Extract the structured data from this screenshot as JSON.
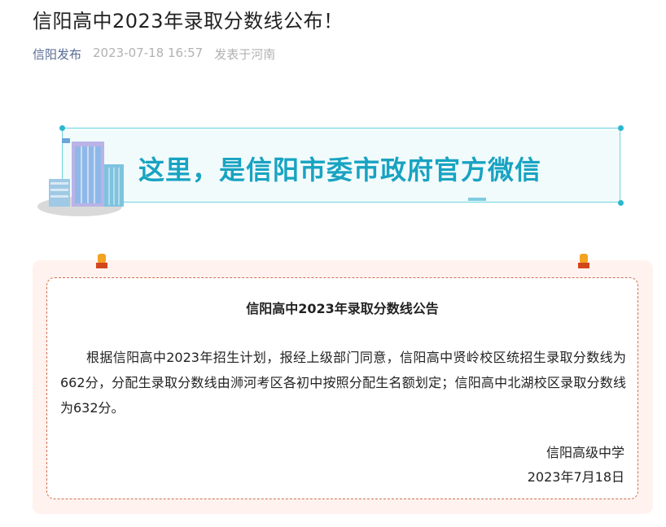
{
  "article": {
    "title": "信阳高中2023年录取分数线公布！",
    "author": "信阳发布",
    "datetime": "2023-07-18 16:57",
    "location": "发表于河南"
  },
  "banner": {
    "text": "这里，是信阳市委市政府官方微信",
    "accent_color": "#18a3c2",
    "icon": "city-buildings-illustration"
  },
  "notice": {
    "title": "信阳高中2023年录取分数线公告",
    "body": "根据信阳高中2023年招生计划，报经上级部门同意，信阳高中贤岭校区统招生录取分数线为662分，分配生录取分数线由浉河考区各初中按照分配生名额划定；信阳高中北湖校区录取分数线为632分。",
    "signature_org": "信阳高级中学",
    "signature_date": "2023年7月18日",
    "card_bg_color": "#fff2ef",
    "border_color": "#d0704e"
  }
}
